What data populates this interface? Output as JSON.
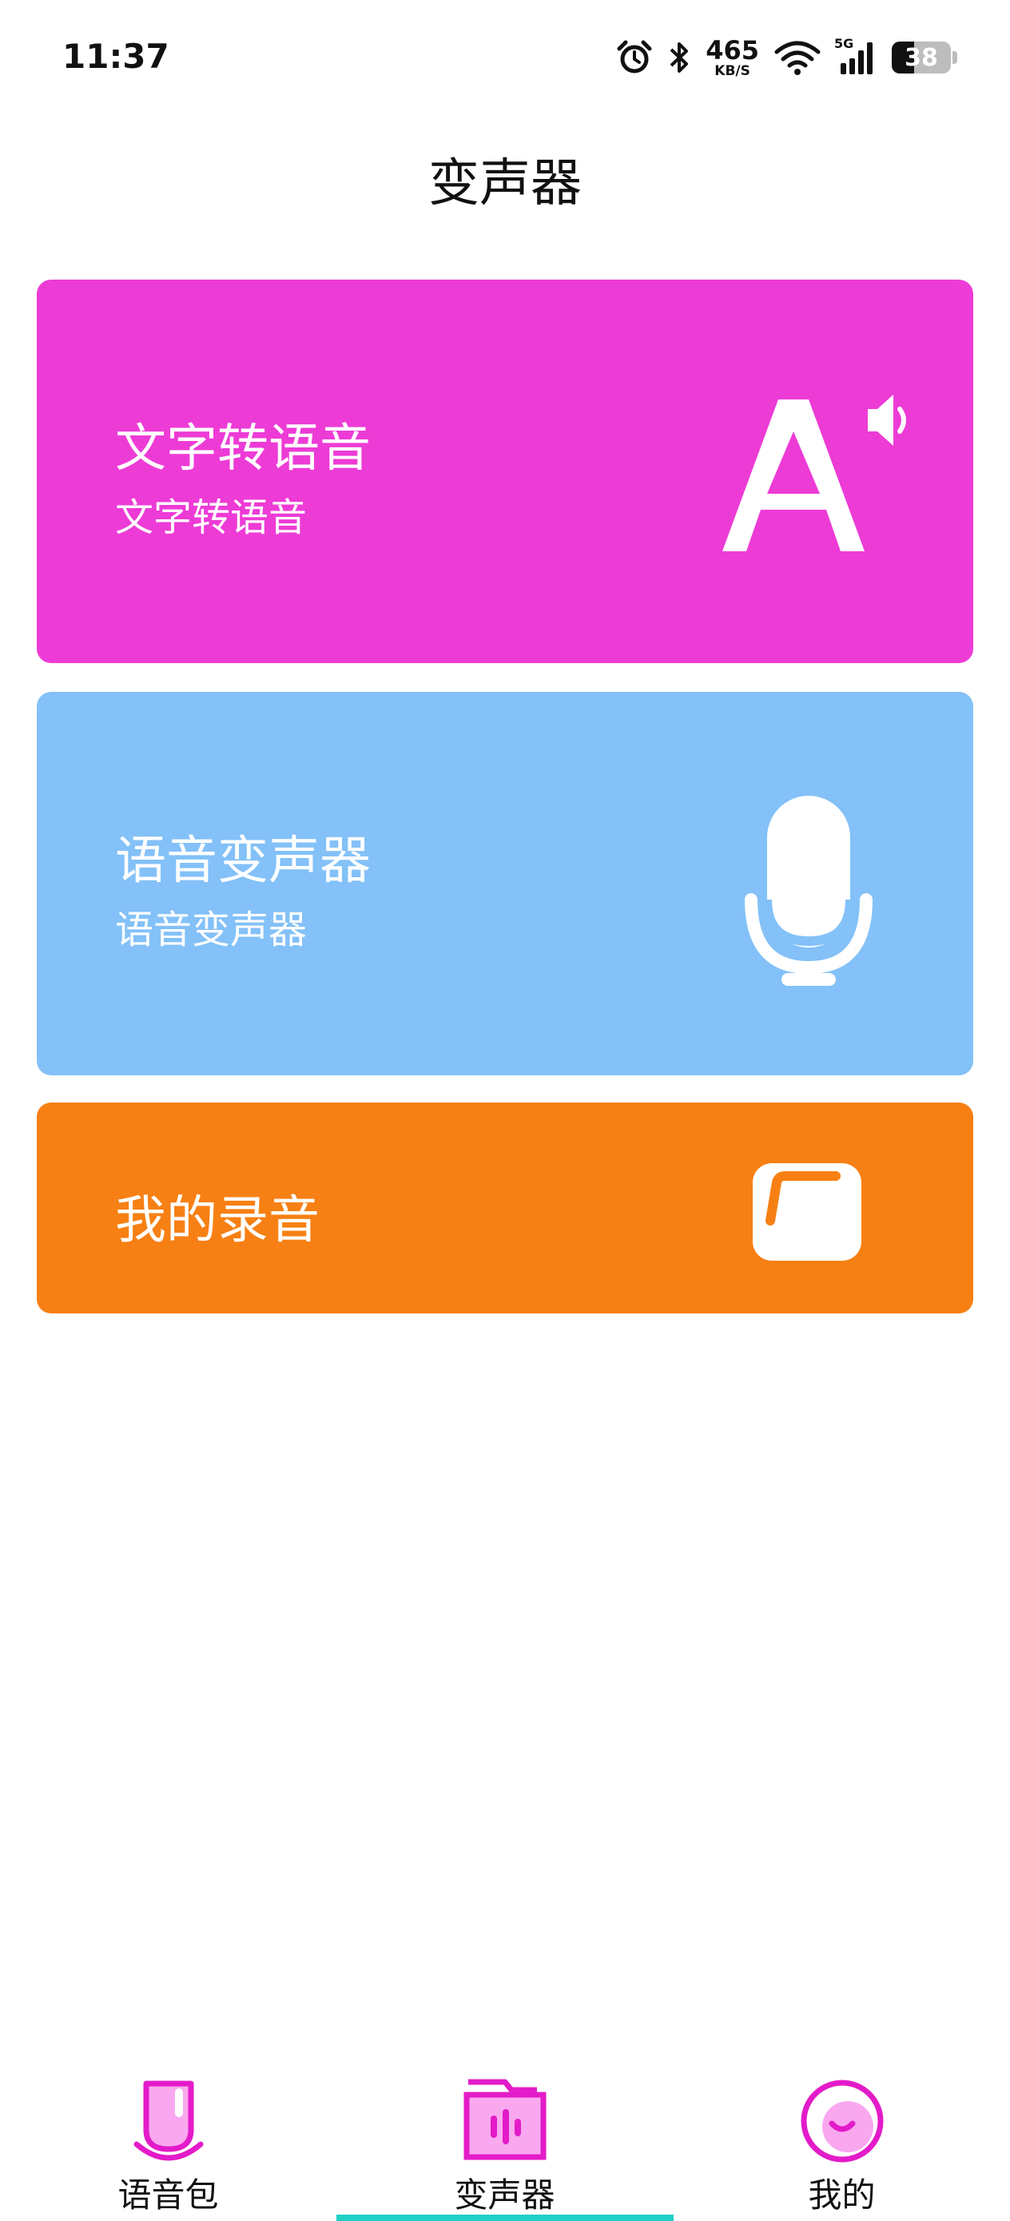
{
  "status_bar": {
    "time": "11:37",
    "net_speed_value": "465",
    "net_speed_unit": "KB/S",
    "network_type": "5G",
    "battery_level": "38",
    "battery_fraction": 0.38,
    "icons": [
      "alarm-icon",
      "bluetooth-icon",
      "wifi-icon",
      "cellular-signal-icon",
      "battery-icon"
    ]
  },
  "header": {
    "title": "变声器"
  },
  "cards": {
    "text_to_speech": {
      "title": "文字转语音",
      "subtitle": "文字转语音",
      "color": "#ED3BD6",
      "icon": "text-speaker-icon"
    },
    "voice_changer": {
      "title": "语音变声器",
      "subtitle": "语音变声器",
      "color": "#83C1F8",
      "icon": "microphone-icon"
    },
    "my_recordings": {
      "title": "我的录音",
      "color": "#F78014",
      "icon": "folder-icon"
    }
  },
  "bottom_nav": {
    "items": [
      {
        "label": "语音包",
        "icon": "voice-pack-icon"
      },
      {
        "label": "变声器",
        "icon": "voice-changer-icon",
        "active": true
      },
      {
        "label": "我的",
        "icon": "profile-icon"
      }
    ],
    "accent_color": "#E31BC9",
    "indicator_color": "#1FD1C5"
  }
}
